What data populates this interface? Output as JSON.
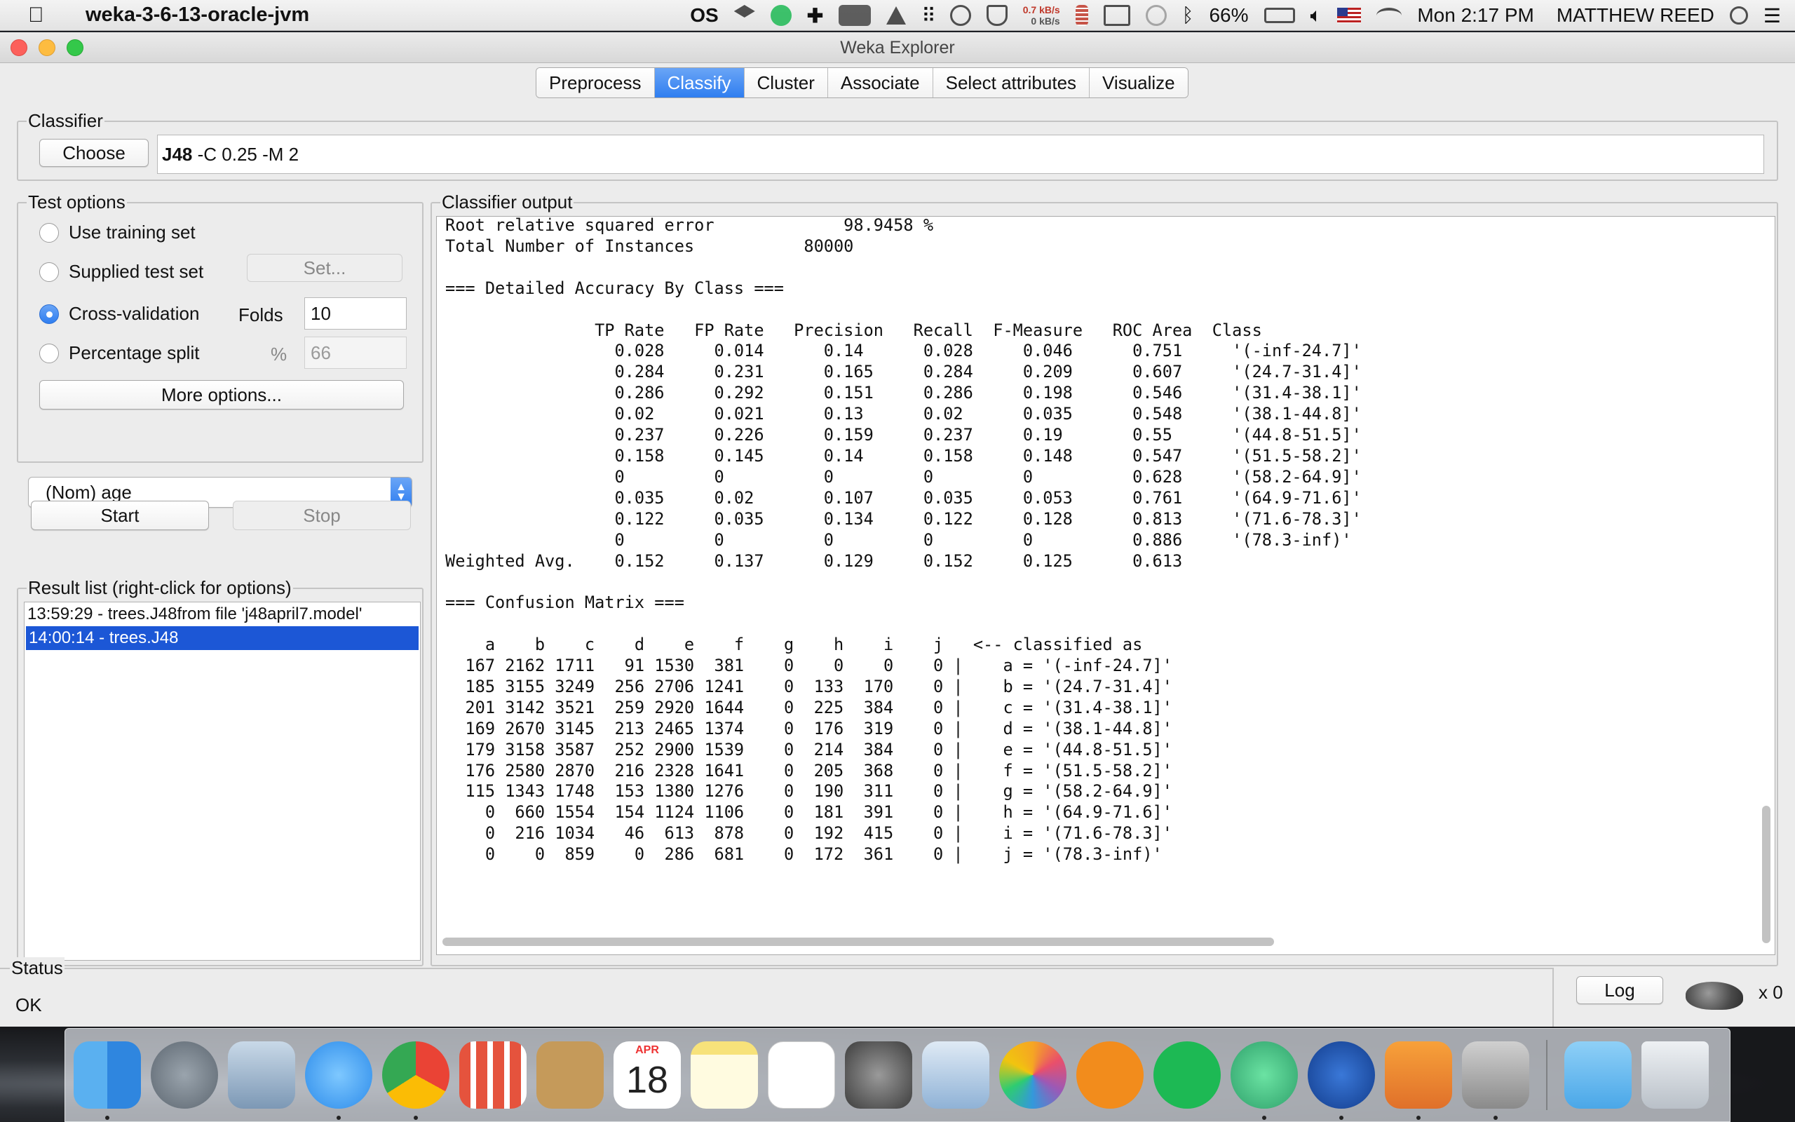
{
  "menubar": {
    "app_name": "weka-3-6-13-oracle-jvm",
    "net_up": "0.7 kB/s",
    "net_down": "0 kB/s",
    "battery": "66%",
    "clock": "Mon 2:17 PM",
    "user": "MATTHEW REED",
    "icons": [
      "apple-icon",
      "os-icon",
      "dropbox-icon",
      "spotify-icon",
      "plus-icon",
      "adobe-icon",
      "drive-icon",
      "grid-icon",
      "circle-slash-icon",
      "shield-icon",
      "activity-icon",
      "airplay-icon",
      "chat-icon",
      "bluetooth-icon",
      "battery-icon",
      "volume-icon",
      "flag-icon",
      "wifi-icon",
      "search-icon",
      "list-icon"
    ]
  },
  "window": {
    "title": "Weka Explorer",
    "tabs": [
      "Preprocess",
      "Classify",
      "Cluster",
      "Associate",
      "Select attributes",
      "Visualize"
    ],
    "active_tab": "Classify"
  },
  "classifier": {
    "group_title": "Classifier",
    "choose_label": "Choose",
    "name": "J48",
    "options": " -C 0.25 -M 2"
  },
  "test_options": {
    "group_title": "Test options",
    "use_training": "Use training set",
    "supplied": "Supplied test set",
    "set_button": "Set...",
    "cross_validation": "Cross-validation",
    "folds_label": "Folds",
    "folds_value": "10",
    "percentage_split": "Percentage split",
    "percent_symbol": "%",
    "percent_value": "66",
    "more_options": "More options...",
    "selected": "Cross-validation"
  },
  "class_attribute": "(Nom) age",
  "controls": {
    "start": "Start",
    "stop": "Stop"
  },
  "result_list": {
    "group_title": "Result list (right-click for options)",
    "items": [
      "13:59:29 - trees.J48from file 'j48april7.model'",
      "14:00:14 - trees.J48"
    ],
    "selected_index": 1
  },
  "output": {
    "group_title": "Classifier output",
    "lines": [
      "Root relative squared error             98.9458 %",
      "Total Number of Instances           80000",
      "",
      "=== Detailed Accuracy By Class ===",
      "",
      "               TP Rate   FP Rate   Precision   Recall  F-Measure   ROC Area  Class",
      "                 0.028     0.014      0.14      0.028     0.046      0.751     '(-inf-24.7]'",
      "                 0.284     0.231      0.165     0.284     0.209      0.607     '(24.7-31.4]'",
      "                 0.286     0.292      0.151     0.286     0.198      0.546     '(31.4-38.1]'",
      "                 0.02      0.021      0.13      0.02      0.035      0.548     '(38.1-44.8]'",
      "                 0.237     0.226      0.159     0.237     0.19       0.55      '(44.8-51.5]'",
      "                 0.158     0.145      0.14      0.158     0.148      0.547     '(51.5-58.2]'",
      "                 0         0          0         0         0          0.628     '(58.2-64.9]'",
      "                 0.035     0.02       0.107     0.035     0.053      0.761     '(64.9-71.6]'",
      "                 0.122     0.035      0.134     0.122     0.128      0.813     '(71.6-78.3]'",
      "                 0         0          0         0         0          0.886     '(78.3-inf)'",
      "Weighted Avg.    0.152     0.137      0.129     0.152     0.125      0.613",
      "",
      "=== Confusion Matrix ===",
      "",
      "    a    b    c    d    e    f    g    h    i    j   <-- classified as",
      "  167 2162 1711   91 1530  381    0    0    0    0 |    a = '(-inf-24.7]'",
      "  185 3155 3249  256 2706 1241    0  133  170    0 |    b = '(24.7-31.4]'",
      "  201 3142 3521  259 2920 1644    0  225  384    0 |    c = '(31.4-38.1]'",
      "  169 2670 3145  213 2465 1374    0  176  319    0 |    d = '(38.1-44.8]'",
      "  179 3158 3587  252 2900 1539    0  214  384    0 |    e = '(44.8-51.5]'",
      "  176 2580 2870  216 2328 1641    0  205  368    0 |    f = '(51.5-58.2]'",
      "  115 1343 1748  153 1380 1276    0  190  311    0 |    g = '(58.2-64.9]'",
      "    0  660 1554  154 1124 1106    0  181  391    0 |    h = '(64.9-71.6]'",
      "    0  216 1034   46  613  878    0  192  415    0 |    i = '(71.6-78.3]'",
      "    0    0  859    0  286  681    0  172  361    0 |    j = '(78.3-inf)'"
    ]
  },
  "status": {
    "group_title": "Status",
    "text": "OK",
    "log_label": "Log",
    "task_count": "x 0"
  },
  "dock": {
    "calendar_month": "APR",
    "calendar_day": "18",
    "apps": [
      "finder-icon",
      "launchpad-icon",
      "mail-icon",
      "messages-icon",
      "chrome-icon",
      "app-grid-icon",
      "contacts-icon",
      "calendar-icon",
      "notes-icon",
      "reminders-icon",
      "system-preferences-icon",
      "preview-icon",
      "photos-icon",
      "ibooks-icon",
      "spotify-icon",
      "atom-icon",
      "weka-icon",
      "pages-icon",
      "utility-icon",
      "downloads-folder-icon",
      "trash-icon"
    ]
  }
}
